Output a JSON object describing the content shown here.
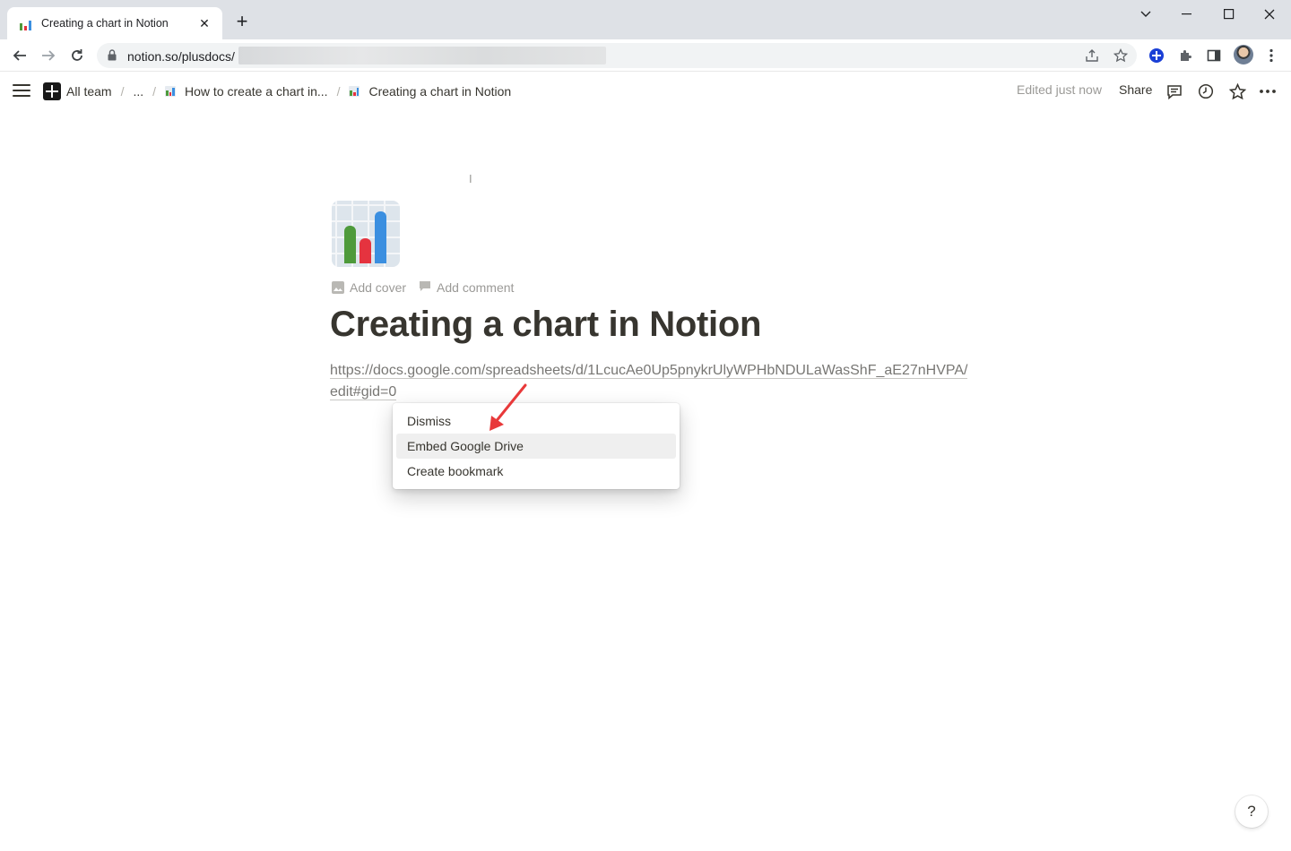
{
  "browser": {
    "tab_title": "Creating a chart in Notion",
    "tab_close": "✕",
    "new_tab": "+",
    "url": "notion.so/plusdocs/"
  },
  "topbar": {
    "workspace": "All team",
    "ellipsis": "...",
    "separator": "/",
    "crumb_parent": "How to create a chart in...",
    "crumb_current": "Creating a chart in Notion",
    "edited": "Edited just now",
    "share": "Share"
  },
  "page": {
    "add_cover": "Add cover",
    "add_comment": "Add comment",
    "title": "Creating a chart in Notion",
    "pasted_url": "https://docs.google.com/spreadsheets/d/1LcucAe0Up5pnykrUlyWPHbNDULaWasShF_aE27nHVPA/edit#gid=0"
  },
  "menu": {
    "items": [
      "Dismiss",
      "Embed Google Drive",
      "Create bookmark"
    ],
    "highlighted_index": 1
  },
  "help_label": "?",
  "colors": {
    "arrow": "#e8393a",
    "bar_green": "#4e9a3b",
    "bar_red": "#e5333f",
    "bar_blue": "#3b8fe0"
  }
}
